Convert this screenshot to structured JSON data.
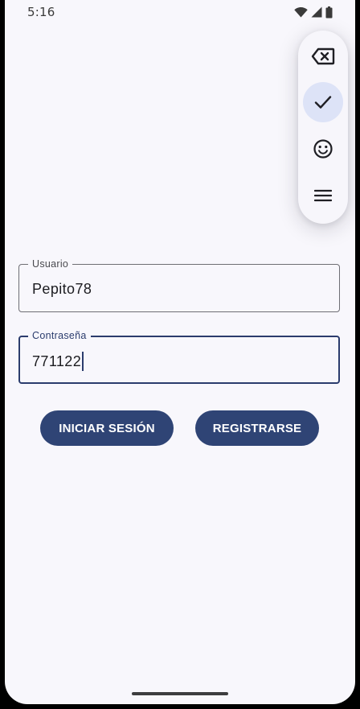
{
  "status_bar": {
    "time": "5:16",
    "icons": [
      "wifi-icon",
      "cell-signal-icon",
      "battery-icon"
    ]
  },
  "floating_toolbar": {
    "buttons": [
      {
        "icon": "backspace-icon",
        "active": false
      },
      {
        "icon": "check-icon",
        "active": true
      },
      {
        "icon": "emoji-icon",
        "active": false
      },
      {
        "icon": "menu-icon",
        "active": false
      }
    ]
  },
  "form": {
    "username": {
      "label": "Usuario",
      "value": "Pepito78"
    },
    "password": {
      "label": "Contraseña",
      "value": "771122",
      "focused": true
    }
  },
  "actions": {
    "login_label": "INICIAR SESIÓN",
    "register_label": "REGISTRARSE"
  },
  "colors": {
    "background": "#f8f7fc",
    "primary": "#2f4475",
    "focus_border": "#2b3c6d",
    "active_chip": "#dde3f7"
  }
}
